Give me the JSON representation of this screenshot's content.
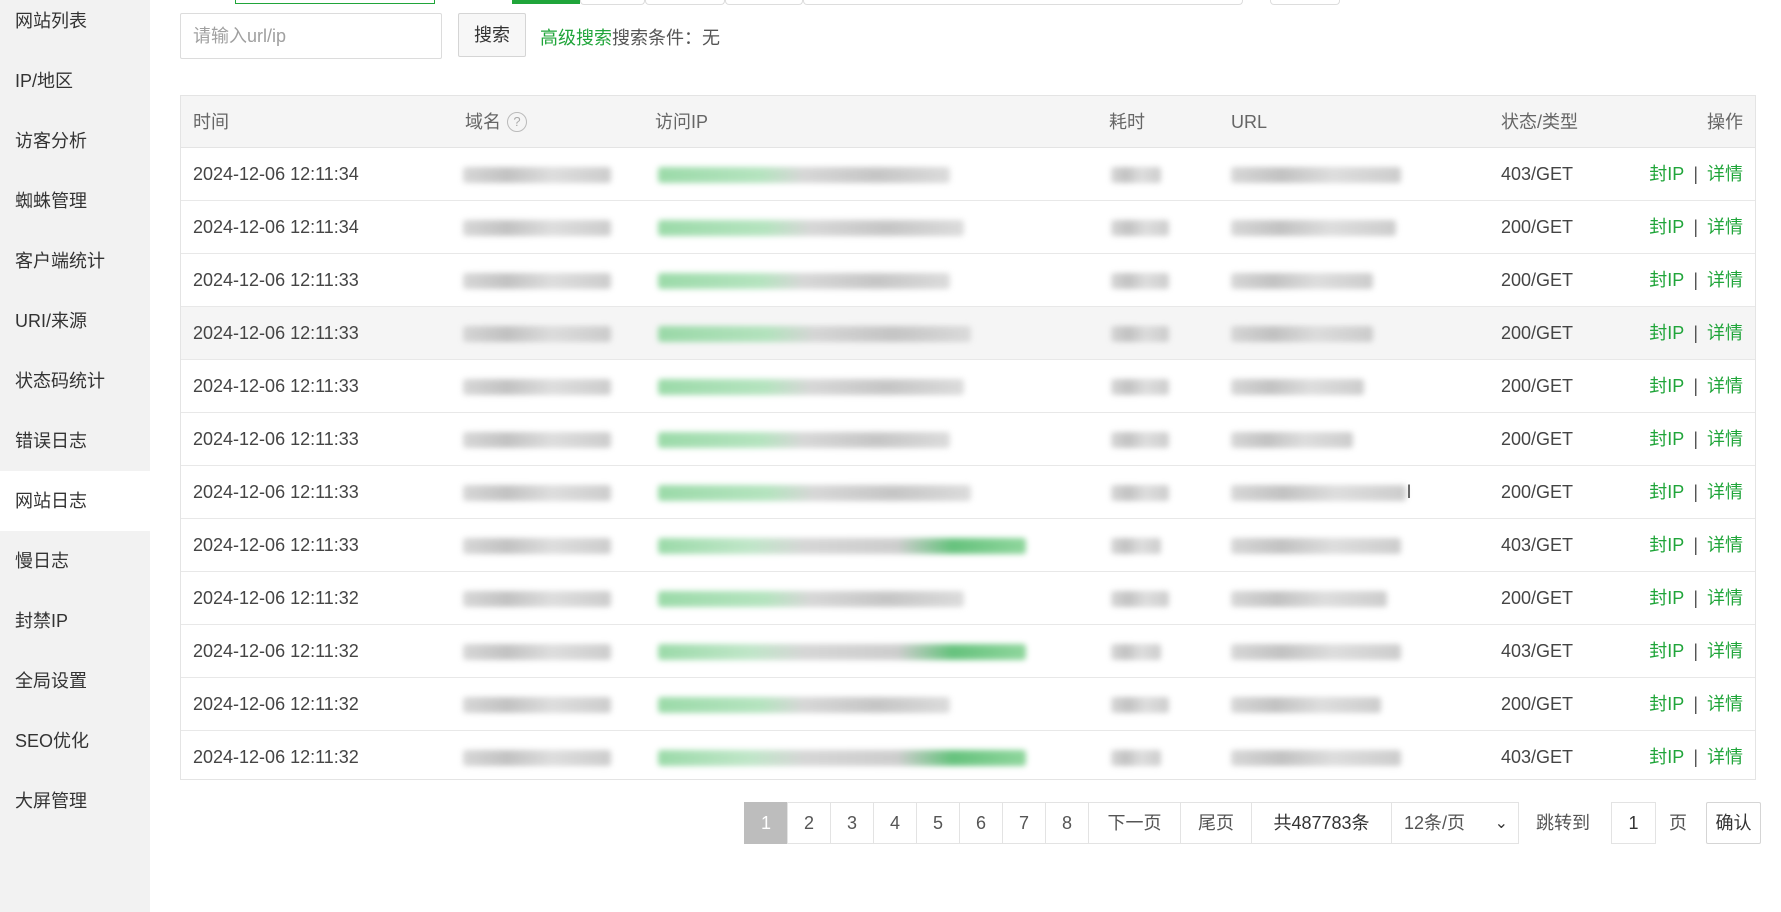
{
  "sidebar": {
    "items": [
      {
        "label": "网站列表"
      },
      {
        "label": "IP/地区"
      },
      {
        "label": "访客分析"
      },
      {
        "label": "蜘蛛管理"
      },
      {
        "label": "客户端统计"
      },
      {
        "label": "URI/来源"
      },
      {
        "label": "状态码统计"
      },
      {
        "label": "错误日志"
      },
      {
        "label": "网站日志",
        "active": true
      },
      {
        "label": "慢日志"
      },
      {
        "label": "封禁IP"
      },
      {
        "label": "全局设置"
      },
      {
        "label": "SEO优化"
      },
      {
        "label": "大屏管理"
      }
    ]
  },
  "search": {
    "placeholder": "请输入url/ip",
    "button_label": "搜索",
    "advanced_label": "高级搜索",
    "conditions_label": "搜索条件：无"
  },
  "table": {
    "headers": {
      "time": "时间",
      "domain": "域名",
      "ip": "访问IP",
      "duration": "耗时",
      "url": "URL",
      "status": "状态/类型",
      "actions": "操作"
    },
    "help_icon": "question-circle-icon",
    "rows": [
      {
        "time": "2024-12-06 12:11:34",
        "status": "403/GET",
        "ban": "封IP",
        "detail": "详情"
      },
      {
        "time": "2024-12-06 12:11:34",
        "status": "200/GET",
        "ban": "封IP",
        "detail": "详情"
      },
      {
        "time": "2024-12-06 12:11:33",
        "status": "200/GET",
        "ban": "封IP",
        "detail": "详情"
      },
      {
        "time": "2024-12-06 12:11:33",
        "status": "200/GET",
        "ban": "封IP",
        "detail": "详情"
      },
      {
        "time": "2024-12-06 12:11:33",
        "status": "200/GET",
        "ban": "封IP",
        "detail": "详情"
      },
      {
        "time": "2024-12-06 12:11:33",
        "status": "200/GET",
        "ban": "封IP",
        "detail": "详情"
      },
      {
        "time": "2024-12-06 12:11:33",
        "status": "200/GET",
        "ban": "封IP",
        "detail": "详情",
        "url_suffix": "l"
      },
      {
        "time": "2024-12-06 12:11:33",
        "status": "403/GET",
        "ban": "封IP",
        "detail": "详情"
      },
      {
        "time": "2024-12-06 12:11:32",
        "status": "200/GET",
        "ban": "封IP",
        "detail": "详情"
      },
      {
        "time": "2024-12-06 12:11:32",
        "status": "403/GET",
        "ban": "封IP",
        "detail": "详情"
      },
      {
        "time": "2024-12-06 12:11:32",
        "status": "200/GET",
        "ban": "封IP",
        "detail": "详情"
      },
      {
        "time": "2024-12-06 12:11:32",
        "status": "403/GET",
        "ban": "封IP",
        "detail": "详情"
      }
    ]
  },
  "pagination": {
    "pages": [
      "1",
      "2",
      "3",
      "4",
      "5",
      "6",
      "7",
      "8"
    ],
    "current": "1",
    "next_label": "下一页",
    "last_label": "尾页",
    "total_label": "共487783条",
    "page_size_label": "12条/页",
    "goto_label": "跳转到",
    "goto_value": "1",
    "page_unit": "页",
    "confirm_label": "确认"
  },
  "colors": {
    "accent": "#20a53a",
    "sidebar_bg": "#f2f2f2",
    "header_bg": "#f5f5f5"
  }
}
